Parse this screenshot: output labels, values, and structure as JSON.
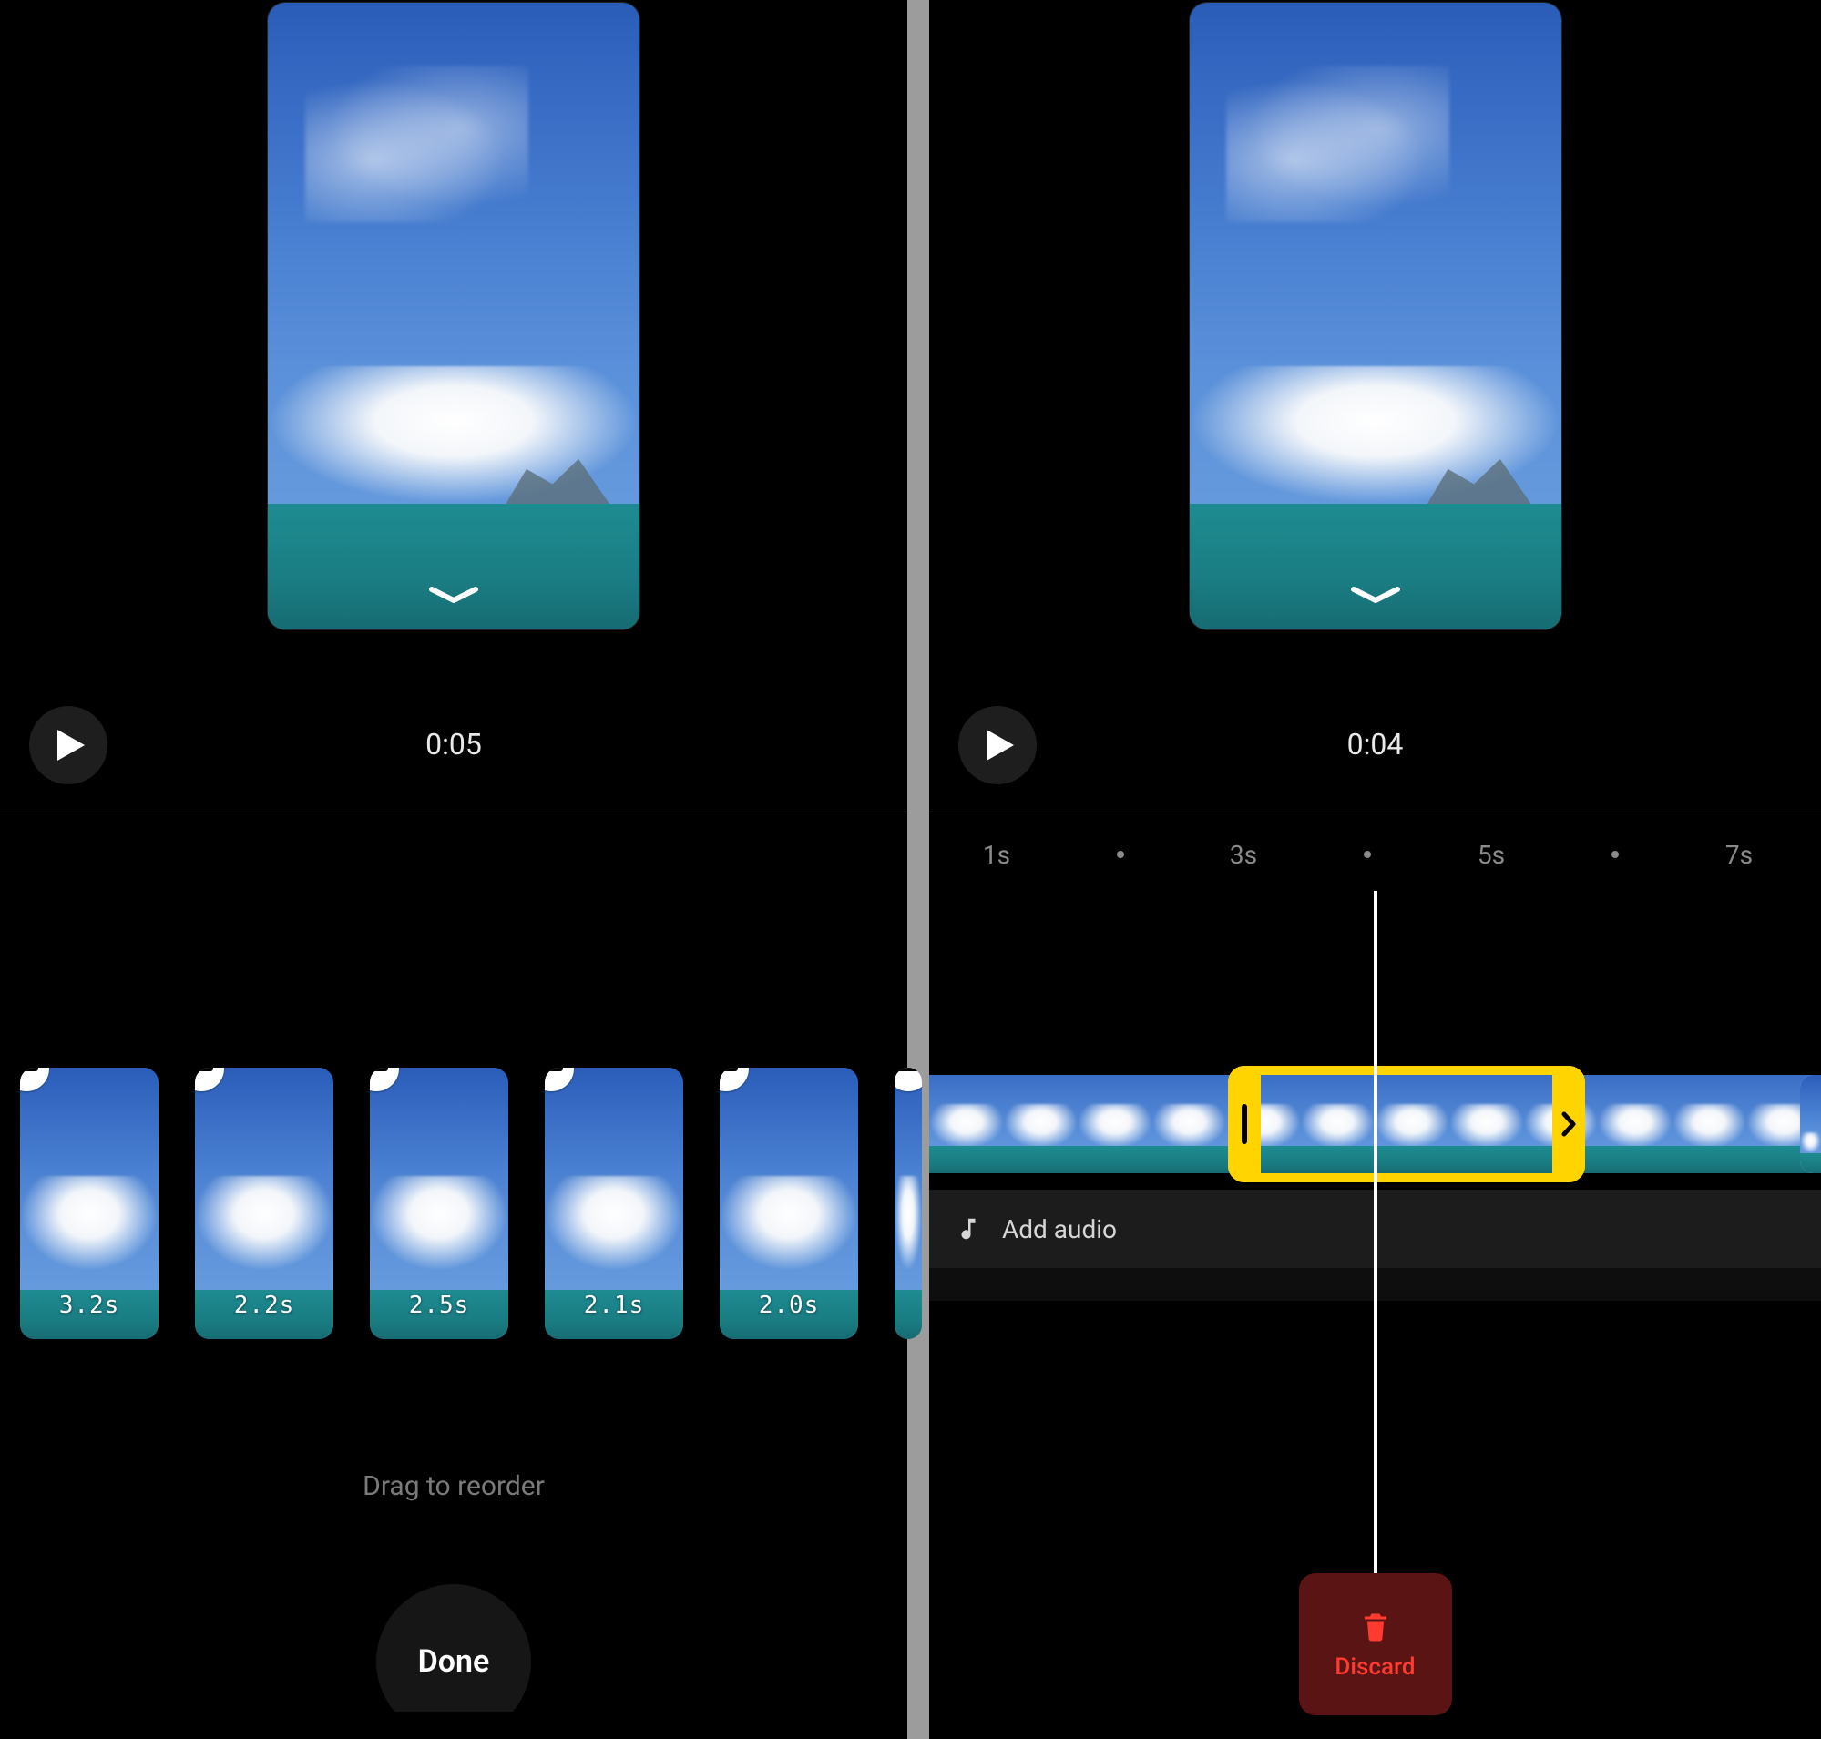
{
  "left": {
    "time": "0:05",
    "clips": [
      {
        "duration": "3.2s"
      },
      {
        "duration": "2.2s"
      },
      {
        "duration": "2.5s"
      },
      {
        "duration": "2.1s"
      },
      {
        "duration": "2.0s"
      }
    ],
    "hint": "Drag to reorder",
    "done": "Done"
  },
  "right": {
    "time": "0:04",
    "ruler": {
      "labels": [
        "1s",
        "3s",
        "5s",
        "7s"
      ]
    },
    "audio_label": "Add audio",
    "discard": "Discard"
  }
}
